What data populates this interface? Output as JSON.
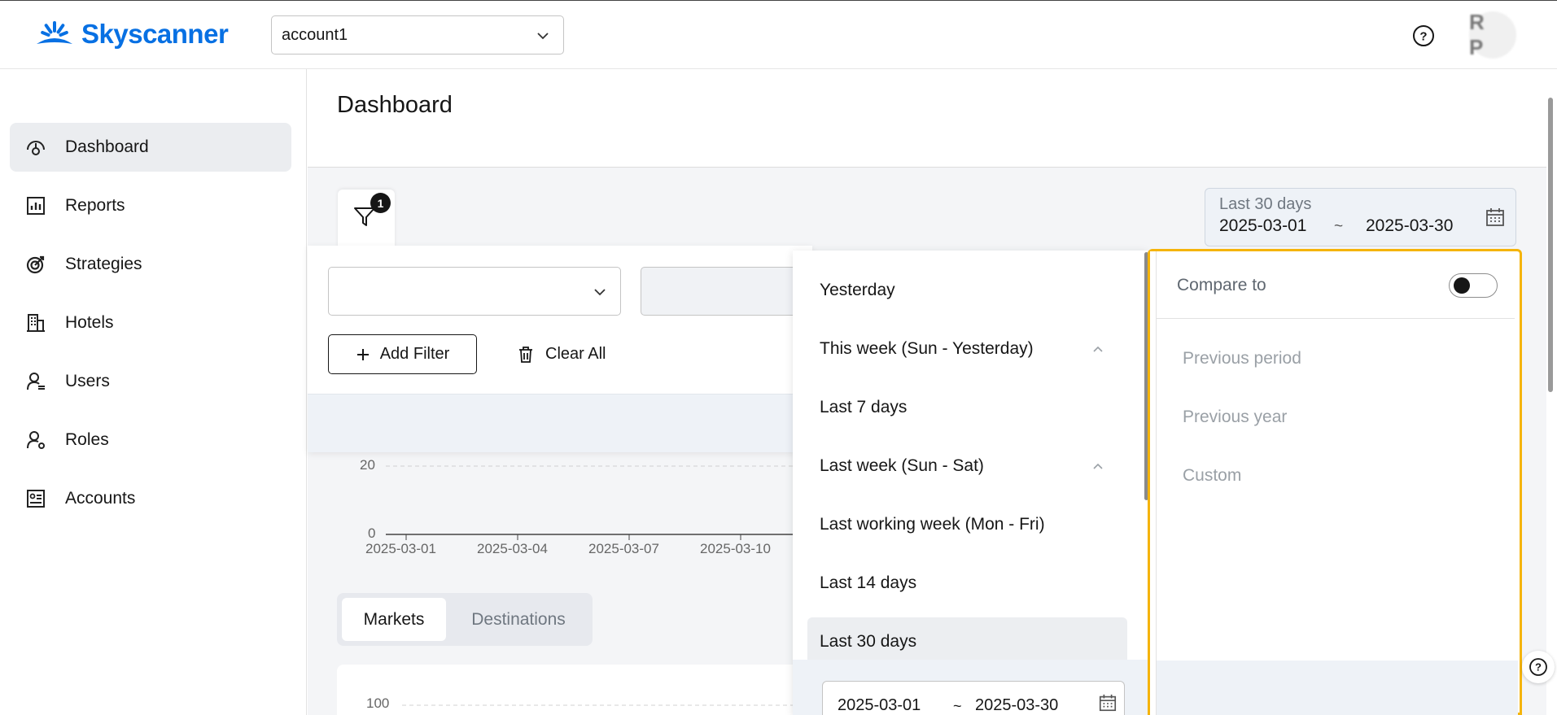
{
  "header": {
    "brand": "Skyscanner",
    "account_select": {
      "value": "account1"
    },
    "avatar_initials": "R P"
  },
  "sidebar": {
    "items": [
      {
        "label": "Dashboard",
        "icon": "dashboard-icon",
        "active": true
      },
      {
        "label": "Reports",
        "icon": "reports-icon"
      },
      {
        "label": "Strategies",
        "icon": "strategies-icon"
      },
      {
        "label": "Hotels",
        "icon": "hotels-icon"
      },
      {
        "label": "Users",
        "icon": "users-icon"
      },
      {
        "label": "Roles",
        "icon": "roles-icon"
      },
      {
        "label": "Accounts",
        "icon": "accounts-icon"
      }
    ]
  },
  "main": {
    "title": "Dashboard",
    "filter_badge": "1",
    "date_range": {
      "label": "Last 30 days",
      "start": "2025-03-01",
      "separator": "~",
      "end": "2025-03-30"
    },
    "filters": {
      "add_filter": "Add Filter",
      "clear_all": "Clear All"
    },
    "chart1": {
      "y_ticks": [
        "20",
        "0"
      ],
      "x_ticks": [
        "2025-03-01",
        "2025-03-04",
        "2025-03-07",
        "2025-03-10"
      ]
    },
    "tabs": [
      {
        "label": "Markets",
        "active": true
      },
      {
        "label": "Destinations",
        "active": false
      }
    ],
    "chart2": {
      "y_ticks": [
        "100"
      ]
    }
  },
  "presets": {
    "items": [
      {
        "label": "Yesterday",
        "expandable": false
      },
      {
        "label": "This week (Sun - Yesterday)",
        "expandable": true
      },
      {
        "label": "Last 7 days",
        "expandable": false
      },
      {
        "label": "Last week (Sun - Sat)",
        "expandable": true
      },
      {
        "label": "Last working week (Mon - Fri)",
        "expandable": false
      },
      {
        "label": "Last 14 days",
        "expandable": false
      },
      {
        "label": "Last 30 days",
        "expandable": false,
        "selected": true
      }
    ],
    "range_input": {
      "start": "2025-03-01",
      "separator": "~",
      "end": "2025-03-30"
    }
  },
  "compare": {
    "label": "Compare to",
    "enabled": false,
    "options": [
      "Previous period",
      "Previous year",
      "Custom"
    ]
  },
  "colors": {
    "brand": "#0770e3",
    "highlight_border": "#f5b40b",
    "active_nav_bg": "#ebedf0"
  }
}
